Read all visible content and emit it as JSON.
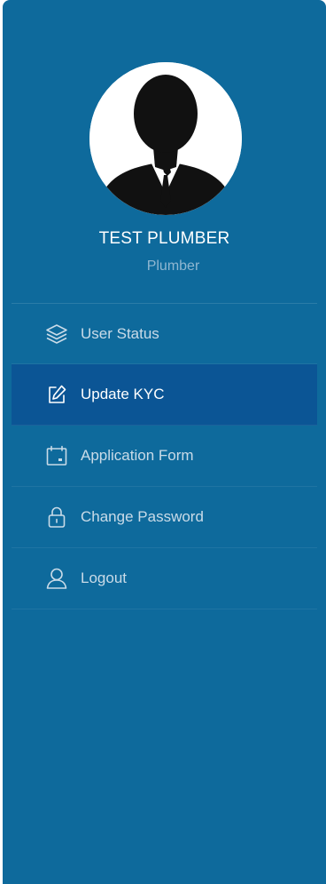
{
  "profile": {
    "name": "TEST PLUMBER",
    "role": "Plumber"
  },
  "menu": {
    "items": [
      {
        "label": "User Status",
        "icon": "layers-icon",
        "active": false
      },
      {
        "label": "Update KYC",
        "icon": "edit-icon",
        "active": true
      },
      {
        "label": "Application Form",
        "icon": "calendar-icon",
        "active": false
      },
      {
        "label": "Change Password",
        "icon": "lock-icon",
        "active": false
      },
      {
        "label": "Logout",
        "icon": "user-icon",
        "active": false
      }
    ]
  },
  "colors": {
    "sidebar_bg": "#0e6a9c",
    "active_bg": "#0b5595",
    "text": "#c9dbe8",
    "muted": "#8fb7d1"
  }
}
